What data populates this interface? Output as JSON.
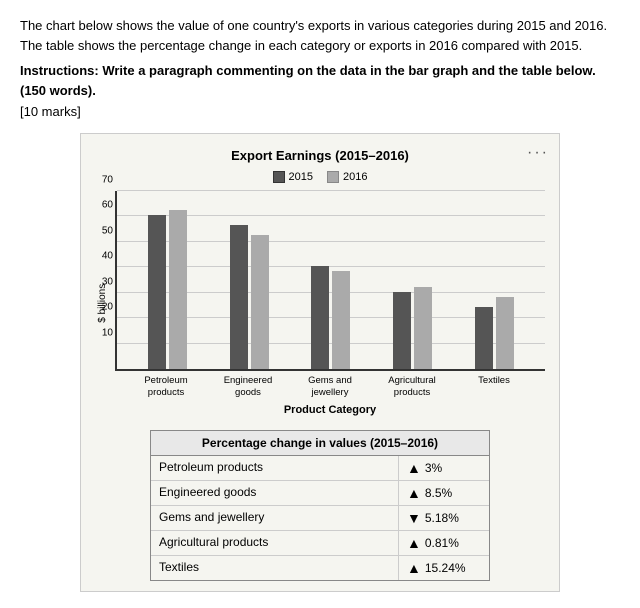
{
  "description": "The chart below shows the value of one country's exports in various categories during 2015 and 2016. The table shows the percentage change in each category or exports in 2016 compared with 2015.",
  "instructions": "Instructions: Write a paragraph commenting on the data in the bar graph and the table below. (150 words).",
  "marks": "[10 marks]",
  "chart": {
    "title": "Export Earnings (2015–2016)",
    "y_axis_label": "$ billions",
    "x_axis_title": "Product Category",
    "legend": {
      "label_2015": "2015",
      "label_2016": "2016"
    },
    "y_ticks": [
      10,
      20,
      30,
      40,
      50,
      60,
      70
    ],
    "y_max": 70,
    "categories": [
      {
        "name": "Petroleum\nproducts",
        "value_2015": 60,
        "value_2016": 62
      },
      {
        "name": "Engineered\ngoods",
        "value_2015": 56,
        "value_2016": 52
      },
      {
        "name": "Gems and\njewellery",
        "value_2015": 40,
        "value_2016": 38
      },
      {
        "name": "Agricultural\nproducts",
        "value_2015": 30,
        "value_2016": 32
      },
      {
        "name": "Textiles",
        "value_2015": 24,
        "value_2016": 28
      }
    ]
  },
  "table": {
    "header": "Percentage change in values (2015–2016)",
    "rows": [
      {
        "category": "Petroleum products",
        "direction": "up",
        "value": "3%"
      },
      {
        "category": "Engineered goods",
        "direction": "up",
        "value": "8.5%"
      },
      {
        "category": "Gems and jewellery",
        "direction": "down",
        "value": "5.18%"
      },
      {
        "category": "Agricultural products",
        "direction": "up",
        "value": "0.81%"
      },
      {
        "category": "Textiles",
        "direction": "up",
        "value": "15.24%"
      }
    ]
  }
}
